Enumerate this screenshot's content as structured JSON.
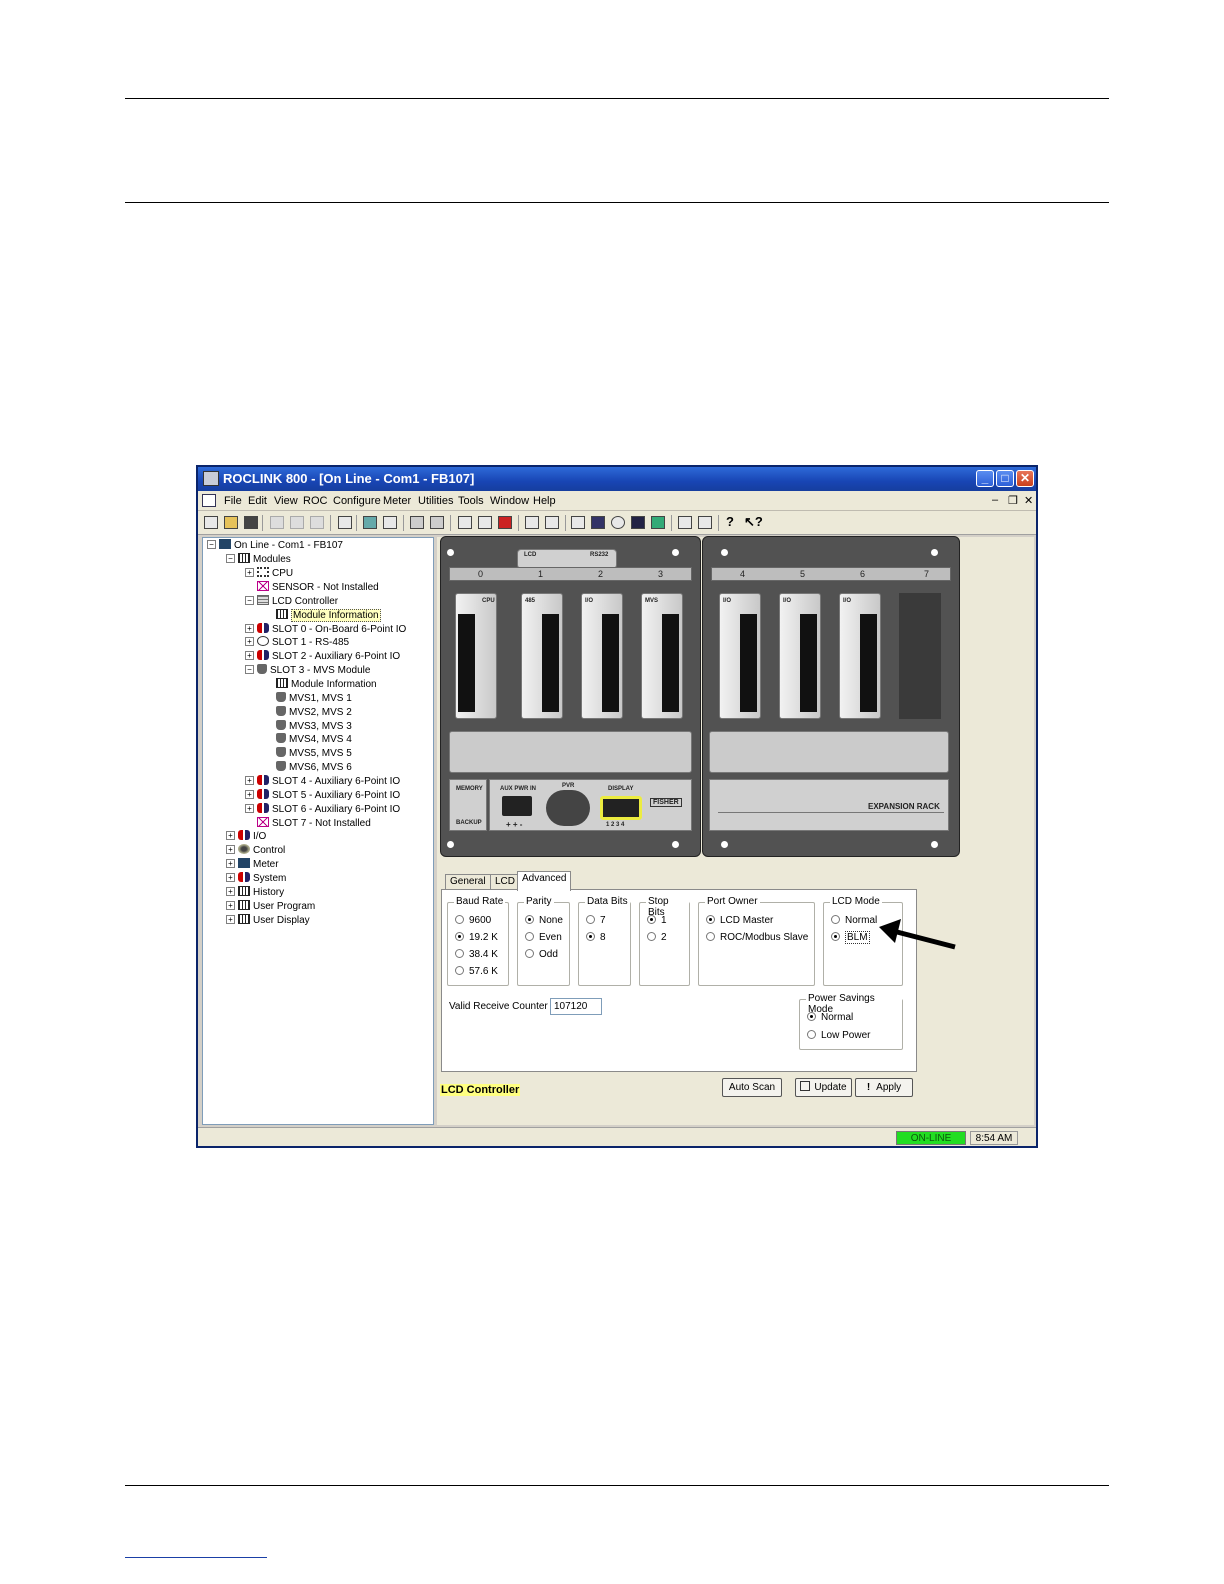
{
  "window": {
    "title": "ROCLINK 800 - [On Line - Com1 - FB107]",
    "menus": [
      "File",
      "Edit",
      "View",
      "ROC",
      "Configure",
      "Meter",
      "Utilities",
      "Tools",
      "Window",
      "Help"
    ],
    "mdi_controls": [
      "–",
      "❐",
      "✕"
    ]
  },
  "tree": {
    "root": "On Line - Com1 - FB107",
    "modules": "Modules",
    "cpu": "CPU",
    "sensor": "SENSOR - Not Installed",
    "lcd": "LCD Controller",
    "lcd_info": "Module Information",
    "slot0": "SLOT 0 - On-Board 6-Point IO",
    "slot1": "SLOT 1 - RS-485",
    "slot2": "SLOT 2 - Auxiliary 6-Point IO",
    "slot3": "SLOT 3 - MVS Module",
    "slot3_info": "Module Information",
    "mvs": [
      "MVS1, MVS 1",
      "MVS2, MVS 2",
      "MVS3, MVS 3",
      "MVS4, MVS 4",
      "MVS5, MVS 5",
      "MVS6, MVS 6"
    ],
    "slot4": "SLOT 4 - Auxiliary 6-Point IO",
    "slot5": "SLOT 5 - Auxiliary 6-Point IO",
    "slot6": "SLOT 6 - Auxiliary 6-Point IO",
    "slot7": "SLOT 7 - Not Installed",
    "io": "I/O",
    "control": "Control",
    "meter": "Meter",
    "system": "System",
    "history": "History",
    "user_program": "User Program",
    "user_display": "User Display"
  },
  "rack": {
    "main_slots": [
      "0",
      "1",
      "2",
      "3"
    ],
    "exp_slots": [
      "4",
      "5",
      "6",
      "7"
    ],
    "header_lcd": "LCD",
    "header_rs232": "RS232",
    "module_labels": [
      "CPU",
      "485",
      "I/O",
      "MVS",
      "I/O",
      "I/O",
      "I/O"
    ],
    "memory_top": "MEMORY",
    "memory_bottom": "BACKUP",
    "aux_pwr": "AUX PWR IN",
    "aux_pins": "+ + -",
    "pvr": "PVR",
    "display": "DISPLAY",
    "display_pins": "1 2 3 4",
    "fisher": "FISHER",
    "expansion": "EXPANSION RACK"
  },
  "tabs": [
    "General",
    "LCD",
    "Advanced"
  ],
  "groups": {
    "baud": {
      "title": "Baud Rate",
      "options": [
        "9600",
        "19.2 K",
        "38.4 K",
        "57.6 K"
      ],
      "selected": 1
    },
    "parity": {
      "title": "Parity",
      "options": [
        "None",
        "Even",
        "Odd"
      ],
      "selected": 0
    },
    "databits": {
      "title": "Data Bits",
      "options": [
        "7",
        "8"
      ],
      "selected": 1
    },
    "stopbits": {
      "title": "Stop Bits",
      "options": [
        "1",
        "2"
      ],
      "selected": 0
    },
    "portowner": {
      "title": "Port Owner",
      "options": [
        "LCD Master",
        "ROC/Modbus Slave"
      ],
      "selected": 0
    },
    "lcdmode": {
      "title": "LCD Mode",
      "options": [
        "Normal",
        "BLM"
      ],
      "selected": 1
    },
    "power": {
      "title": "Power Savings Mode",
      "options": [
        "Normal",
        "Low Power"
      ],
      "selected": 0
    }
  },
  "valid_receive": {
    "label": "Valid Receive Counter :",
    "value": "107120"
  },
  "footer": {
    "label": "LCD Controller",
    "autoscan": "Auto Scan",
    "update": "Update",
    "apply": "Apply"
  },
  "status": {
    "online": "ON-LINE",
    "time": "8:54 AM"
  }
}
